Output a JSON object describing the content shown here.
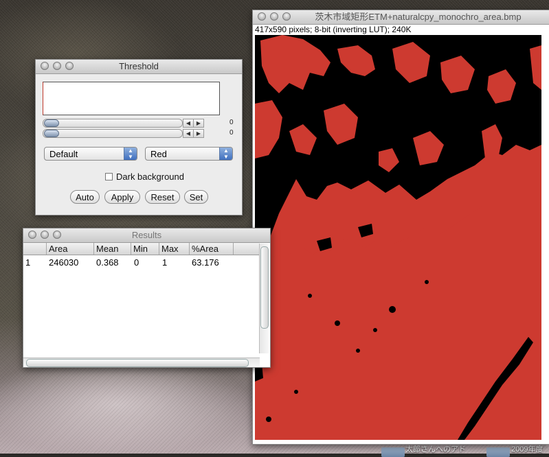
{
  "colors": {
    "threshold_overlay": "#cd3a30",
    "background": "#000000",
    "select_accent": "#3f6fbe"
  },
  "image_window": {
    "title": "茨木市域矩形ETM+naturalcpy_monochro_area.bmp",
    "info": "417x590 pixels; 8-bit (inverting LUT); 240K"
  },
  "threshold_window": {
    "title": "Threshold",
    "sliders": [
      {
        "value": "0",
        "position": 0
      },
      {
        "value": "0",
        "position": 0
      }
    ],
    "method_select": "Default",
    "mode_select": "Red",
    "dark_background_label": "Dark background",
    "dark_background_checked": false,
    "buttons": [
      "Auto",
      "Apply",
      "Reset",
      "Set"
    ]
  },
  "results_window": {
    "title": "Results",
    "columns": [
      "",
      "Area",
      "Mean",
      "Min",
      "Max",
      "%Area"
    ],
    "rows": [
      [
        "1",
        "246030",
        "0.368",
        "0",
        "1",
        "63.176"
      ]
    ]
  },
  "desktop": {
    "icon_label_1": "太郎さんへのアド",
    "icon_label_2": "2009年度"
  }
}
